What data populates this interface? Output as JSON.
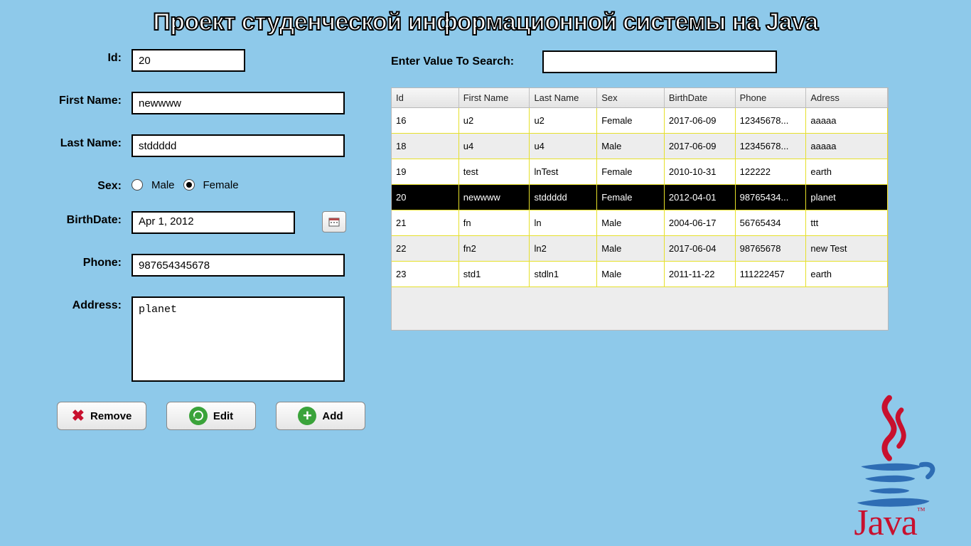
{
  "page_title": "Проект студенческой информационной системы на Java",
  "form": {
    "id_label": "Id:",
    "id_value": "20",
    "fname_label": "First Name:",
    "fname_value": "newwww",
    "lname_label": "Last Name:",
    "lname_value": "stddddd",
    "sex_label": "Sex:",
    "sex_male_label": "Male",
    "sex_female_label": "Female",
    "sex_selected": "Female",
    "birth_label": "BirthDate:",
    "birth_value": "Apr 1, 2012",
    "phone_label": "Phone:",
    "phone_value": "987654345678",
    "address_label": "Address:",
    "address_value": "planet"
  },
  "buttons": {
    "remove": "Remove",
    "edit": "Edit",
    "add": "Add"
  },
  "search": {
    "label": "Enter Value To Search:",
    "value": ""
  },
  "table": {
    "headers": [
      "Id",
      "First Name",
      "Last Name",
      "Sex",
      "BirthDate",
      "Phone",
      "Adress"
    ],
    "selected_id": "20",
    "rows": [
      {
        "id": "16",
        "fname": "u2",
        "lname": "u2",
        "sex": "Female",
        "birth": "2017-06-09",
        "phone": "12345678...",
        "address": "aaaaa"
      },
      {
        "id": "18",
        "fname": "u4",
        "lname": "u4",
        "sex": "Male",
        "birth": "2017-06-09",
        "phone": "12345678...",
        "address": "aaaaa"
      },
      {
        "id": "19",
        "fname": "test",
        "lname": "lnTest",
        "sex": "Female",
        "birth": "2010-10-31",
        "phone": "122222",
        "address": "earth"
      },
      {
        "id": "20",
        "fname": "newwww",
        "lname": "stddddd",
        "sex": "Female",
        "birth": "2012-04-01",
        "phone": "98765434...",
        "address": "planet"
      },
      {
        "id": "21",
        "fname": "fn",
        "lname": "ln",
        "sex": "Male",
        "birth": "2004-06-17",
        "phone": "56765434",
        "address": "ttt"
      },
      {
        "id": "22",
        "fname": "fn2",
        "lname": "ln2",
        "sex": "Male",
        "birth": "2017-06-04",
        "phone": "98765678",
        "address": "new Test"
      },
      {
        "id": "23",
        "fname": "std1",
        "lname": "stdln1",
        "sex": "Male",
        "birth": "2011-11-22",
        "phone": "111222457",
        "address": "earth"
      }
    ]
  },
  "logo": {
    "text": "Java",
    "tm": "™"
  }
}
